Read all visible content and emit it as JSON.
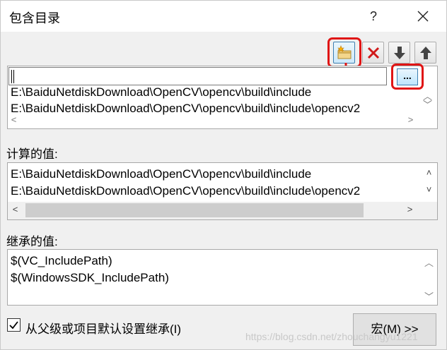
{
  "window": {
    "title": "包含目录",
    "help_label": "?"
  },
  "toolbar": {
    "buttons": [
      {
        "icon": "new-folder-icon",
        "highlighted": true
      },
      {
        "icon": "delete-icon"
      },
      {
        "icon": "move-down-icon"
      },
      {
        "icon": "move-up-icon"
      }
    ],
    "highlight_color": "#e01515"
  },
  "directories_list": {
    "edit_value": "",
    "browse_label": "...",
    "items": [
      "E:\\BaiduNetdiskDownload\\OpenCV\\opencv\\build\\include",
      "E:\\BaiduNetdiskDownload\\OpenCV\\opencv\\build\\include\\opencv2"
    ]
  },
  "evaluated": {
    "label": "计算的值:",
    "items": [
      "E:\\BaiduNetdiskDownload\\OpenCV\\opencv\\build\\include",
      "E:\\BaiduNetdiskDownload\\OpenCV\\opencv\\build\\include\\opencv2"
    ]
  },
  "inherited": {
    "label": "继承的值:",
    "items": [
      "$(VC_IncludePath)",
      "$(WindowsSDK_IncludePath)"
    ]
  },
  "inherit_checkbox": {
    "label": "从父级或项目默认设置继承(I)",
    "checked": true
  },
  "macro_button": {
    "label": "宏(M) >>"
  },
  "watermark": "https://blog.csdn.net/zhouchangyu1221"
}
